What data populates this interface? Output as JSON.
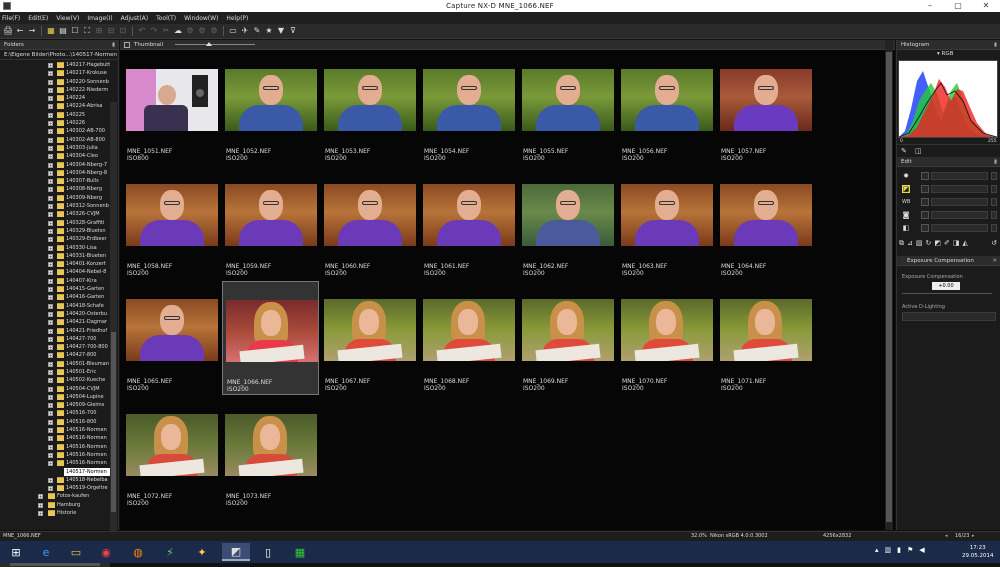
{
  "window": {
    "title": "Capture NX-D      MNE_1066.NEF",
    "minimize": "–",
    "maximize": "▢",
    "close": "✕"
  },
  "menu": [
    "File(F)",
    "Edit(E)",
    "View(V)",
    "Image(I)",
    "Adjust(A)",
    "Tool(T)",
    "Window(W)",
    "Help(P)"
  ],
  "toolbar": [
    "🖨",
    "←",
    "→",
    "▦",
    "▤",
    "☐",
    "⛶",
    "⊞",
    "⊟",
    "⊡",
    "↶",
    "↷",
    "✂",
    "☁",
    "⚙",
    "⚙",
    "⚙",
    "▭",
    "✈",
    "✎",
    "★",
    "▼",
    "⊽"
  ],
  "folders": {
    "tab": "Folders",
    "path": "E:\\Eigene Bilder\\Photo...\\140517-Normen",
    "items": [
      "140217-Hagebutt",
      "140217-Krokuse",
      "140220-Sonnenb",
      "140222-Niederm",
      "140224",
      "140224-Abrisa",
      "140225",
      "140226",
      "140302-AB-700",
      "140302-AB-800",
      "140303-Julia",
      "140304-Cleo",
      "140304-Nberg-7",
      "140304-Nberg-8",
      "140307-Bulls",
      "140308-Nberg",
      "140309-Nberg",
      "140312-Sonnenb",
      "140326-CVJM",
      "140328-Graffiti",
      "140329-Bluetsn",
      "140329-Erdbeer",
      "140330-Lisa",
      "140331-Blueten",
      "140401-Konzert",
      "140404-Nebel-8",
      "140407-Kira",
      "140415-Garten",
      "140416-Garten",
      "140418-Schafe",
      "140420-Osterbu",
      "140421-Dagmar",
      "140421-Friedhof",
      "140427-700",
      "140427-700-800",
      "140427-800",
      "140501-Bleuman",
      "140501-Eric",
      "140502-Kueche",
      "140504-CVJM",
      "140504-Lupine",
      "140509-Gleims",
      "140516-700",
      "140516-800",
      "140516-Normen",
      "140516-Normen",
      "140516-Normen",
      "140516-Normen",
      "140516-Normen",
      "140517-Normen",
      "140518-Nebelba",
      "140519-Orgeltre",
      "Fotos-kaufen",
      "Hamburg",
      "Historie"
    ],
    "selected_index": 49
  },
  "thumbnail_panel": {
    "tab": "Thumbnail"
  },
  "thumbnails": [
    {
      "name": "MNE_1051.NEF",
      "iso": "ISO800",
      "kind": "room"
    },
    {
      "name": "MNE_1052.NEF",
      "iso": "ISO200",
      "kind": "man-g"
    },
    {
      "name": "MNE_1053.NEF",
      "iso": "ISO200",
      "kind": "man-g"
    },
    {
      "name": "MNE_1054.NEF",
      "iso": "ISO200",
      "kind": "man-g"
    },
    {
      "name": "MNE_1055.NEF",
      "iso": "ISO200",
      "kind": "man-g"
    },
    {
      "name": "MNE_1056.NEF",
      "iso": "ISO200",
      "kind": "man-g"
    },
    {
      "name": "MNE_1057.NEF",
      "iso": "ISO200",
      "kind": "man-p"
    },
    {
      "name": "MNE_1058.NEF",
      "iso": "ISO200",
      "kind": "man-o"
    },
    {
      "name": "MNE_1059.NEF",
      "iso": "ISO200",
      "kind": "man-o"
    },
    {
      "name": "MNE_1060.NEF",
      "iso": "ISO200",
      "kind": "man-o"
    },
    {
      "name": "MNE_1061.NEF",
      "iso": "ISO200",
      "kind": "man-o"
    },
    {
      "name": "MNE_1062.NEF",
      "iso": "ISO200",
      "kind": "man-gg"
    },
    {
      "name": "MNE_1063.NEF",
      "iso": "ISO200",
      "kind": "man-o"
    },
    {
      "name": "MNE_1064.NEF",
      "iso": "ISO200",
      "kind": "man-o"
    },
    {
      "name": "MNE_1065.NEF",
      "iso": "ISO200",
      "kind": "man-o"
    },
    {
      "name": "MNE_1066.NEF",
      "iso": "ISO200",
      "kind": "woman-r"
    },
    {
      "name": "MNE_1067.NEF",
      "iso": "ISO200",
      "kind": "woman-g"
    },
    {
      "name": "MNE_1068.NEF",
      "iso": "ISO200",
      "kind": "woman-g"
    },
    {
      "name": "MNE_1069.NEF",
      "iso": "ISO200",
      "kind": "woman-g"
    },
    {
      "name": "MNE_1070.NEF",
      "iso": "ISO200",
      "kind": "woman-g"
    },
    {
      "name": "MNE_1071.NEF",
      "iso": "ISO200",
      "kind": "woman-g"
    },
    {
      "name": "MNE_1072.NEF",
      "iso": "ISO200",
      "kind": "woman-c"
    },
    {
      "name": "MNE_1073.NEF",
      "iso": "ISO200",
      "kind": "woman-c"
    }
  ],
  "selected_thumbnail": 15,
  "histogram": {
    "tab": "Histogram",
    "channel": "RGB",
    "axis_min": "0",
    "axis_max": "255"
  },
  "edit": {
    "tab": "Edit"
  },
  "exposure": {
    "tab": "Exposure Compensation",
    "label": "Exposure Compensation",
    "value": "+0.00",
    "adl_label": "Active D-Lighting"
  },
  "status": {
    "file": "MNE_1066.NEF",
    "zoom": "32.0%",
    "profile": "Nikon sRGB 4.0.0.3002",
    "dims": "4256x2832",
    "count": "16/23"
  },
  "clock": {
    "time": "17:23",
    "date": "29.05.2014"
  },
  "colors": {
    "accent": "#4a6fa5",
    "selected_row": "#ffffff",
    "taskbar": "#1c2a4a"
  }
}
